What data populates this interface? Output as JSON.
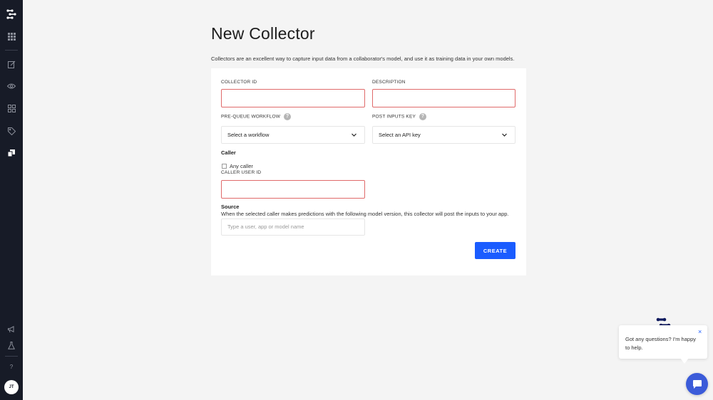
{
  "sidebar": {
    "avatar_initials": "JT",
    "help_label": "?",
    "items": [
      {
        "icon": "clarifai-logo-icon"
      },
      {
        "icon": "apps-grid-icon"
      },
      {
        "icon": "edit-icon"
      },
      {
        "icon": "eye-icon"
      },
      {
        "icon": "dashboard-grid-icon"
      },
      {
        "icon": "tag-icon"
      },
      {
        "icon": "collectors-icon"
      },
      {
        "icon": "megaphone-icon"
      },
      {
        "icon": "flask-icon"
      },
      {
        "icon": "help-icon"
      }
    ]
  },
  "page": {
    "title": "New Collector",
    "description": "Collectors are an excellent way to capture input data from a collaborator's model, and use it as training data in your own models."
  },
  "form": {
    "collector_id_label": "COLLECTOR ID",
    "description_label": "DESCRIPTION",
    "pre_queue_workflow_label": "PRE-QUEUE WORKFLOW",
    "pre_queue_workflow_value": "Select a workflow",
    "post_inputs_key_label": "POST INPUTS KEY",
    "post_inputs_key_value": "Select an API key",
    "help_glyph": "?",
    "caller_heading": "Caller",
    "any_caller_label": "Any caller",
    "caller_user_id_label": "CALLER USER ID",
    "source_heading": "Source",
    "source_description": "When the selected caller makes predictions with the following model version, this collector will post the inputs to your app.",
    "source_placeholder": "Type a user, app or model name",
    "create_label": "CREATE"
  },
  "chat": {
    "message": "Got any questions? I'm happy to help.",
    "close_glyph": "×"
  },
  "colors": {
    "sidebar_bg": "#171b27",
    "accent": "#1a5cff",
    "error_border": "#e06a6a",
    "chat_launcher": "#3b5bd9"
  }
}
